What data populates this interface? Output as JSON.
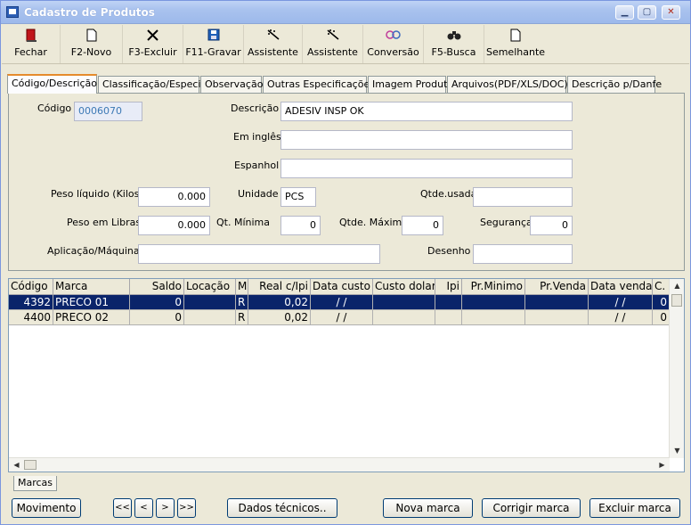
{
  "window": {
    "title": "Cadastro de Produtos",
    "controls": [
      "▁",
      "▢",
      "✕"
    ]
  },
  "toolbar": [
    {
      "label": "Fechar",
      "icon": "exit-door-icon"
    },
    {
      "label": "F2-Novo",
      "icon": "new-page-icon"
    },
    {
      "label": "F3-Excluir",
      "icon": "delete-x-icon"
    },
    {
      "label": "F11-Gravar",
      "icon": "save-floppy-icon"
    },
    {
      "label": "Assistente",
      "icon": "wizard-wand-icon"
    },
    {
      "label": "Assistente",
      "icon": "wizard-wand-icon"
    },
    {
      "label": "Conversão",
      "icon": "conversion-icon"
    },
    {
      "label": "F5-Busca",
      "icon": "binoculars-icon"
    },
    {
      "label": "Semelhante",
      "icon": "page-icon"
    }
  ],
  "tabs": [
    "Código/Descrição",
    "Classificação/Especie",
    "Observação",
    "Outras Especificações",
    "Imagem Produto",
    "Arquivos(PDF/XLS/DOC)",
    "Descrição p/Danfe"
  ],
  "form": {
    "codigo_label": "Código",
    "codigo_value": "0006070",
    "descricao_label": "Descrição",
    "descricao_value": "ADESIV INSP OK",
    "ingles_label": "Em inglês",
    "ingles_value": "",
    "espanhol_label": "Espanhol",
    "espanhol_value": "",
    "peso_liquido_label": "Peso líquido (Kilos)",
    "peso_liquido_value": "0.000",
    "unidade_label": "Unidade",
    "unidade_value": "PCS",
    "qtde_usada_label": "Qtde.usada",
    "qtde_usada_value": "",
    "peso_libras_label": "Peso em Libras",
    "peso_libras_value": "0.000",
    "qt_minima_label": "Qt. Mínima",
    "qt_minima_value": "0",
    "qtde_maxima_label": "Qtde. Máxima",
    "qtde_maxima_value": "0",
    "seguranca_label": "Segurança",
    "seguranca_value": "0",
    "aplicacao_label": "Aplicação/Máquina",
    "aplicacao_value": "",
    "desenho_label": "Desenho",
    "desenho_value": ""
  },
  "grid": {
    "columns": [
      "Código",
      "Marca",
      "Saldo",
      "Locação",
      "M",
      "Real c/Ipi",
      "Data custo",
      "Custo dolar",
      "Ipi",
      "Pr.Minimo",
      "Pr.Venda",
      "Data venda",
      "C."
    ],
    "rows": [
      [
        "4392",
        "PRECO 01",
        "0",
        "",
        "R",
        "0,02",
        "/ /",
        "",
        "",
        "",
        "",
        "/ /",
        "0"
      ],
      [
        "4400",
        "PRECO 02",
        "0",
        "",
        "R",
        "0,02",
        "/ /",
        "",
        "",
        "",
        "",
        "/ /",
        "0"
      ]
    ],
    "selected_row": 0
  },
  "bottom_tab": "Marcas",
  "buttons": {
    "movimento": "Movimento",
    "first": "<<",
    "prev": "<",
    "next": ">",
    "last": ">>",
    "dados_tecnicos": "Dados técnicos..",
    "nova_marca": "Nova marca",
    "corrigir_marca": "Corrigir marca",
    "excluir_marca": "Excluir marca"
  }
}
